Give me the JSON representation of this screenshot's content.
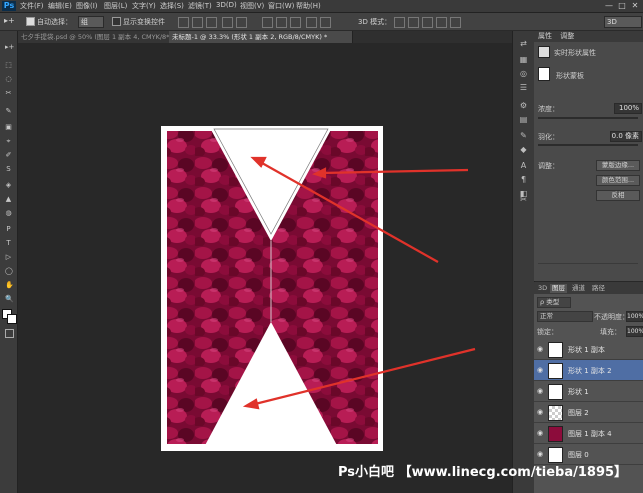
{
  "menubar": {
    "logo": "Ps",
    "items": [
      "文件(F)",
      "编辑(E)",
      "图像(I)",
      "图层(L)",
      "文字(Y)",
      "选择(S)",
      "滤镜(T)",
      "3D(D)",
      "视图(V)",
      "窗口(W)",
      "帮助(H)"
    ],
    "window_buttons": [
      "—",
      "□",
      "✕"
    ]
  },
  "options": {
    "auto_select_label": "自动选择：",
    "auto_select_value": "组",
    "show_transform_label": "显示变换控件",
    "mode_3d_label": "3D 模式：",
    "workspace_value": "3D"
  },
  "tabs": [
    {
      "label": "七夕手提袋.psd @ 50% (图层 1 副本 4, CMYK/8*)",
      "active": false
    },
    {
      "label": "未标题-1 @ 33.3% (形状 1 副本 2, RGB/8/CMYK) *",
      "active": true
    }
  ],
  "tools": [
    "▸+",
    "⬚",
    "◌",
    "✂",
    "✎",
    "▣",
    "⌖",
    "✐",
    "S",
    "◈",
    "▲",
    "◍",
    "P",
    "T",
    "▷",
    "◯",
    "✋",
    "🔍"
  ],
  "color_swatches": {
    "foreground": "#ffffff",
    "background": "#ffffff"
  },
  "properties": {
    "tab1": "属性",
    "tab2": "调整",
    "header_title": "实时形状属性",
    "shape_label": "形状蒙板",
    "density_label": "浓度：",
    "density_value": "100%",
    "feather_label": "羽化：",
    "feather_value": "0.0 像素",
    "refine_label": "调整：",
    "btn_mask_edge": "蒙版边缘...",
    "btn_color_range": "颜色范围...",
    "btn_invert": "反相"
  },
  "right_strip_icons": [
    "⇄",
    "▦",
    "◎",
    "☰",
    "⚙",
    "▤",
    "✎",
    "◆",
    "A",
    "¶",
    "◧",
    "✂"
  ],
  "layers_panel": {
    "tabs": [
      "3D",
      "图层",
      "通道",
      "路径"
    ],
    "filter_label": "ρ 类型",
    "blend_mode": "正常",
    "opacity_label": "不透明度：",
    "opacity_value": "100%",
    "lock_label": "锁定：",
    "fill_label": "填充：",
    "fill_value": "100%",
    "layers": [
      {
        "name": "形状 1 副本",
        "selected": false
      },
      {
        "name": "形状 1 副本 2",
        "selected": true
      },
      {
        "name": "形状 1",
        "selected": false
      },
      {
        "name": "图层 2",
        "selected": false
      },
      {
        "name": "图层 1 副本 4",
        "selected": false
      },
      {
        "name": "图层 0",
        "selected": false
      }
    ]
  },
  "watermark": "Ps小白吧 【www.linecg.com/tieba/1895】",
  "colors": {
    "petal_dark": "#5a0624",
    "petal_mid": "#9c1044",
    "petal_light": "#c22a5e",
    "arrow": "#e0322a",
    "selection": "#4f6ea4"
  }
}
